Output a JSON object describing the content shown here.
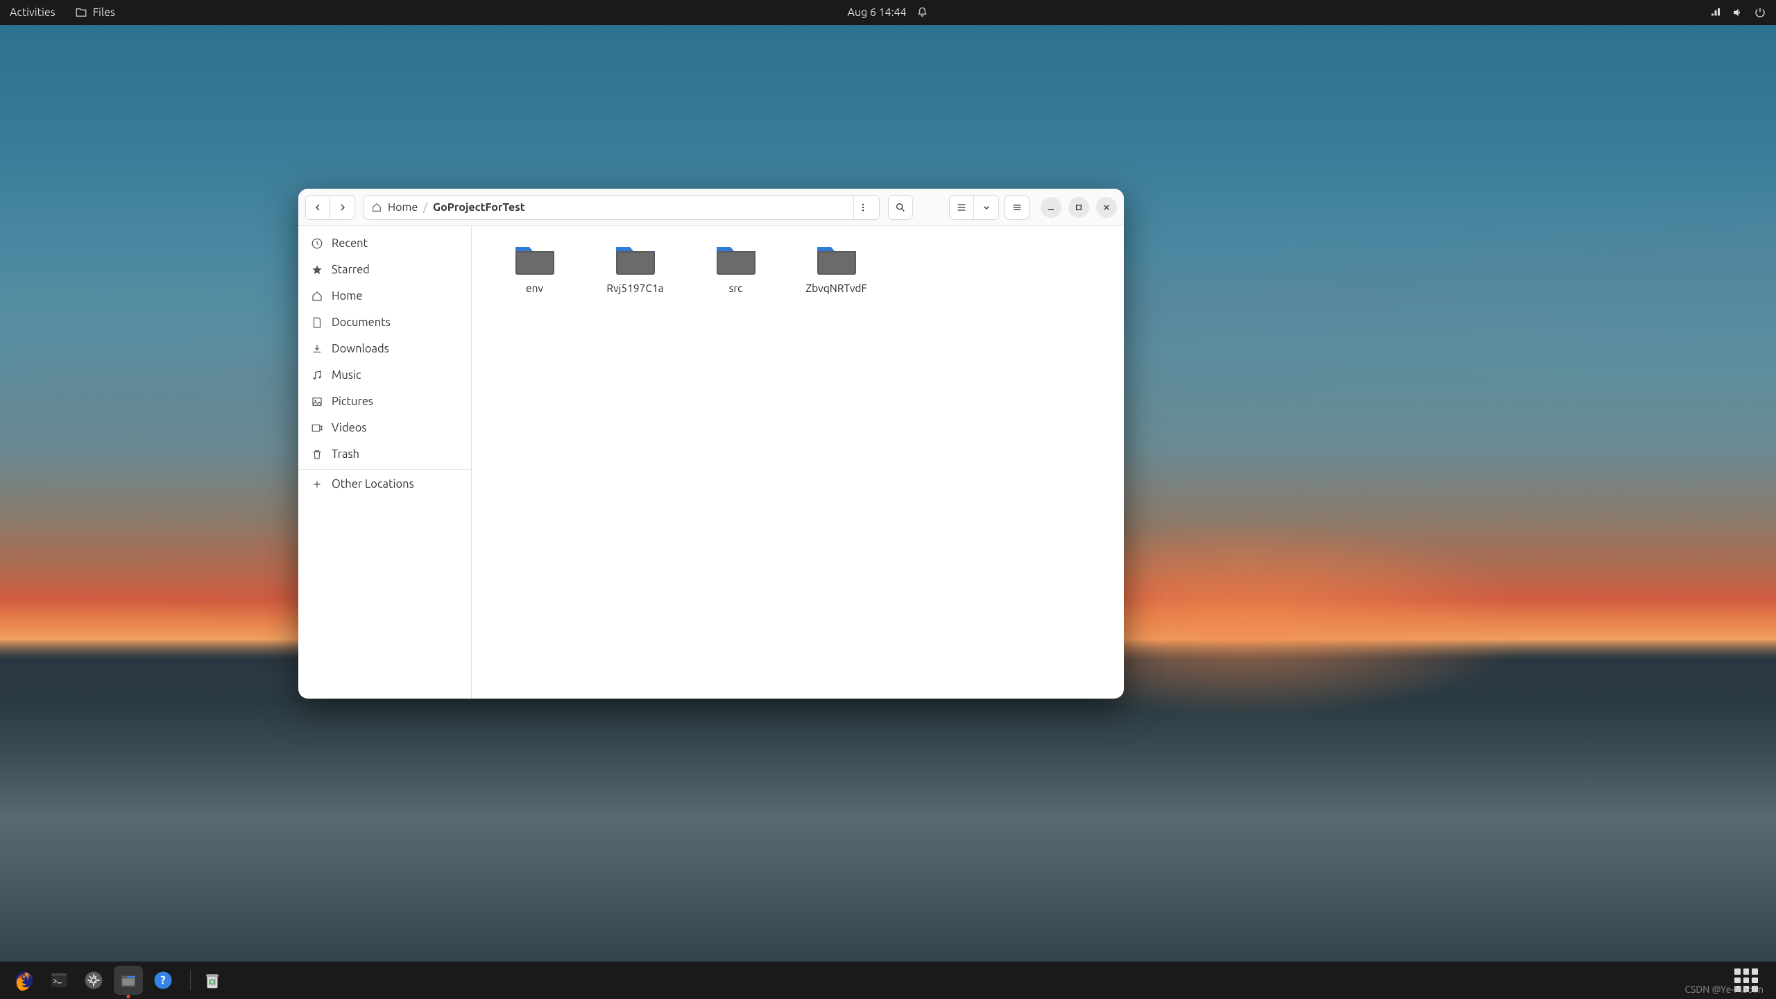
{
  "topbar": {
    "activities": "Activities",
    "app_label": "Files",
    "datetime": "Aug 6  14:44"
  },
  "window": {
    "path_home": "Home",
    "path_current": "GoProjectForTest"
  },
  "sidebar": {
    "items": [
      {
        "label": "Recent"
      },
      {
        "label": "Starred"
      },
      {
        "label": "Home"
      },
      {
        "label": "Documents"
      },
      {
        "label": "Downloads"
      },
      {
        "label": "Music"
      },
      {
        "label": "Pictures"
      },
      {
        "label": "Videos"
      },
      {
        "label": "Trash"
      }
    ],
    "other": "Other Locations"
  },
  "folders": [
    {
      "name": "env"
    },
    {
      "name": "Rvj5197C1a"
    },
    {
      "name": "src"
    },
    {
      "name": "ZbvqNRTvdF"
    }
  ],
  "watermark": "CSDN @Ye-Maolin"
}
